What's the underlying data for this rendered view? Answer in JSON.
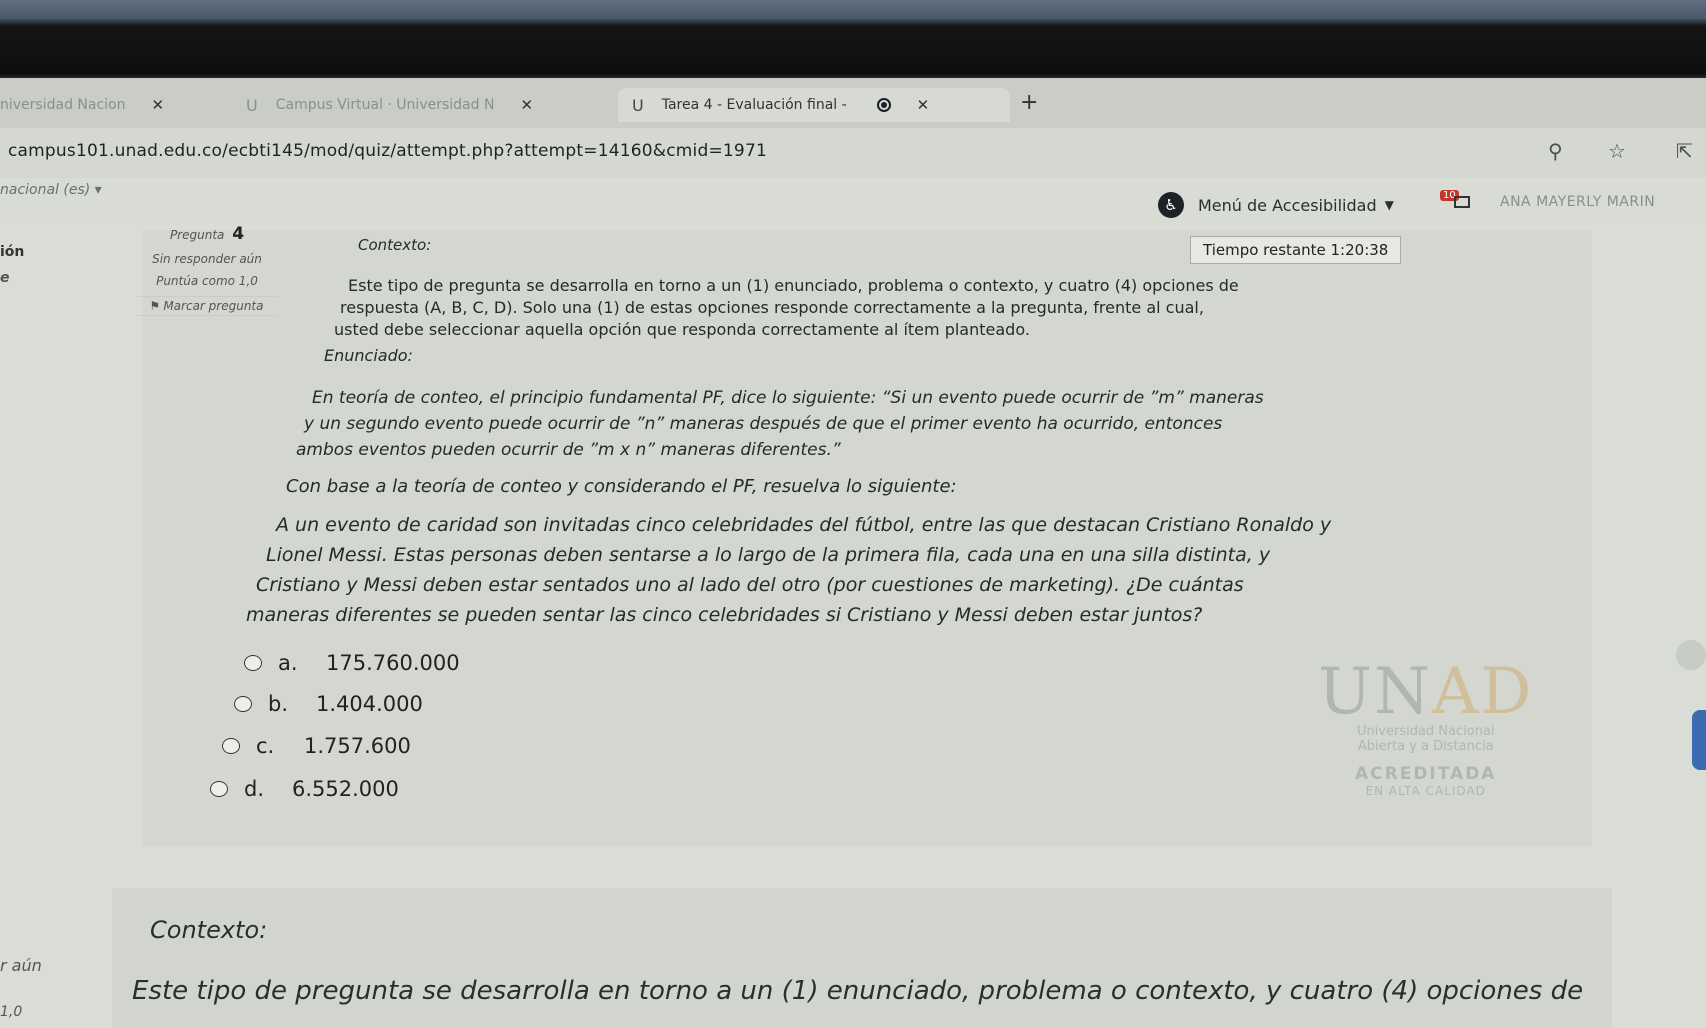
{
  "browser": {
    "tabs": [
      {
        "label": "niversidad Nacion",
        "close": "✕",
        "active": false
      },
      {
        "label": "Campus Virtual · Universidad N",
        "close": "✕",
        "active": false
      },
      {
        "label": "Tarea 4 - Evaluación final -",
        "close": "✕",
        "active": true
      }
    ],
    "new_tab": "+",
    "url": "campus101.unad.edu.co/ecbti145/mod/quiz/attempt.php?attempt=14160&cmid=1971"
  },
  "header": {
    "language": "nacional (es) ▾",
    "accessibility_menu": "Menú de Accesibilidad",
    "message_badge": "10",
    "user_name": "ANA MAYERLY MARIN"
  },
  "edge_fragments": {
    "left1": "ión",
    "left2": "e",
    "left3": "r aún",
    "left4": "1,0"
  },
  "question": {
    "label": "Pregunta",
    "number": "4",
    "status": "Sin responder aún",
    "score": "Puntúa como 1,0",
    "flag": "Marcar pregunta",
    "timer": "Tiempo restante 1:20:38",
    "context_label": "Contexto:",
    "context_lines": [
      "Este tipo de pregunta se desarrolla en torno a un (1) enunciado, problema o contexto, y cuatro (4) opciones de",
      "respuesta (A, B, C, D). Solo una (1) de estas opciones responde correctamente a la pregunta, frente al cual,",
      "usted debe seleccionar aquella opción que responda correctamente al ítem planteado."
    ],
    "statement_label": "Enunciado:",
    "pf_lines": [
      "En teoría de conteo, el principio fundamental PF, dice lo siguiente: “Si un evento puede ocurrir de ”m” maneras",
      "y un segundo evento puede ocurrir de ”n” maneras después de que el primer evento ha ocurrido, entonces",
      "ambos eventos pueden ocurrir de ”m x n” maneras diferentes.”"
    ],
    "instruction": "Con base a la teoría de conteo y considerando el PF, resuelva lo siguiente:",
    "problem_lines": [
      "A un evento de caridad son invitadas cinco celebridades del fútbol, entre las que destacan Cristiano Ronaldo y",
      "Lionel Messi. Estas personas deben sentarse a lo largo de la primera fila, cada una en una silla distinta, y",
      "Cristiano y Messi deben estar sentados uno al lado del otro (por cuestiones de marketing). ¿De cuántas",
      "maneras diferentes se pueden sentar las cinco celebridades si Cristiano y Messi deben estar juntos?"
    ],
    "options": [
      {
        "letter": "a.",
        "value": "175.760.000"
      },
      {
        "letter": "b.",
        "value": "1.404.000"
      },
      {
        "letter": "c.",
        "value": "1.757.600"
      },
      {
        "letter": "d.",
        "value": "6.552.000"
      }
    ]
  },
  "watermark": {
    "logo_left": "UN",
    "logo_right": "AD",
    "line1": "Universidad Nacional",
    "line2": "Abierta y a Distancia",
    "accredited": "ACREDITADA",
    "quality": "EN ALTA CALIDAD"
  },
  "next_question": {
    "context_label": "Contexto:",
    "first_line": "Este tipo de pregunta se desarrolla en torno a un (1) enunciado, problema o contexto, y cuatro (4) opciones de"
  }
}
